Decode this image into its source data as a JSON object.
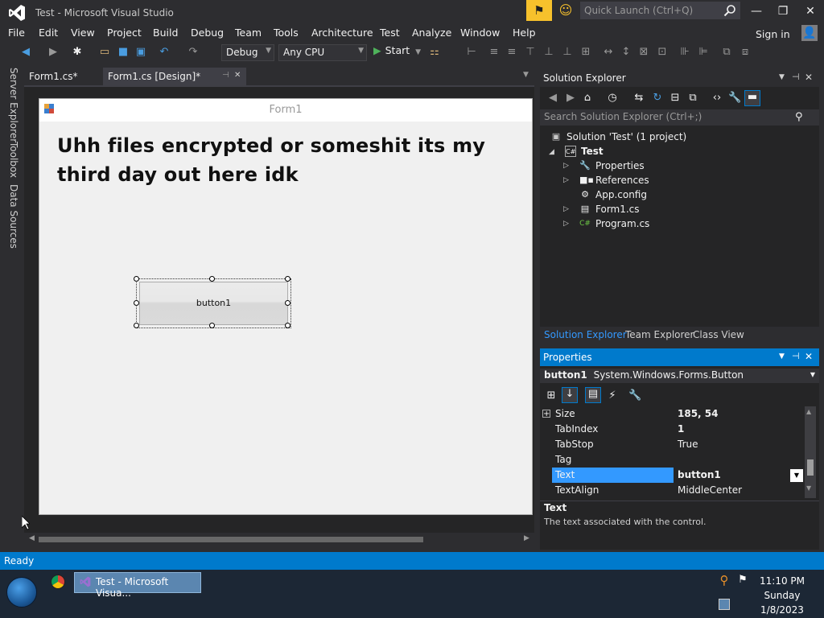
{
  "window": {
    "title": "Test - Microsoft Visual Studio",
    "quick_launch_placeholder": "Quick Launch (Ctrl+Q)"
  },
  "menu": [
    "File",
    "Edit",
    "View",
    "Project",
    "Build",
    "Debug",
    "Team",
    "Tools",
    "Architecture",
    "Test",
    "Analyze",
    "Window",
    "Help"
  ],
  "account": {
    "sign_in": "Sign in"
  },
  "toolbar": {
    "config": "Debug",
    "platform": "Any CPU",
    "start": "Start"
  },
  "doc_tabs": [
    {
      "label": "Form1.cs*"
    },
    {
      "label": "Form1.cs [Design]*",
      "pin": "⊣",
      "close": "✕"
    }
  ],
  "side_rail": [
    "Server Explorer",
    "Toolbox",
    "Data Sources"
  ],
  "designer": {
    "form_title": "Form1",
    "label_text": "Uhh files encrypted or someshit its my third day out here idk",
    "button_text": "button1"
  },
  "solution_explorer": {
    "title": "Solution Explorer",
    "search_placeholder": "Search Solution Explorer (Ctrl+;)",
    "items": [
      {
        "label": "Solution 'Test' (1 project)"
      },
      {
        "label": "Test"
      },
      {
        "label": "Properties"
      },
      {
        "label": "References"
      },
      {
        "label": "App.config"
      },
      {
        "label": "Form1.cs"
      },
      {
        "label": "Program.cs"
      }
    ],
    "tabs": [
      "Solution Explorer",
      "Team Explorer",
      "Class View"
    ]
  },
  "properties": {
    "title": "Properties",
    "object_name": "button1",
    "object_type": "System.Windows.Forms.Button",
    "rows": [
      {
        "name": "Size",
        "value": "185, 54"
      },
      {
        "name": "TabIndex",
        "value": "1"
      },
      {
        "name": "TabStop",
        "value": "True"
      },
      {
        "name": "Tag",
        "value": ""
      },
      {
        "name": "Text",
        "value": "button1"
      },
      {
        "name": "TextAlign",
        "value": "MiddleCenter"
      }
    ],
    "desc_title": "Text",
    "desc_body": "The text associated with the control."
  },
  "status": {
    "text": "Ready"
  },
  "taskbar": {
    "task_label": "Test - Microsoft Visua...",
    "clock_time": "11:10 PM",
    "clock_day": "Sunday",
    "clock_date": "1/8/2023"
  },
  "colors": {
    "accent": "#007acc",
    "background": "#2d2d30",
    "selection": "#3399ff"
  }
}
